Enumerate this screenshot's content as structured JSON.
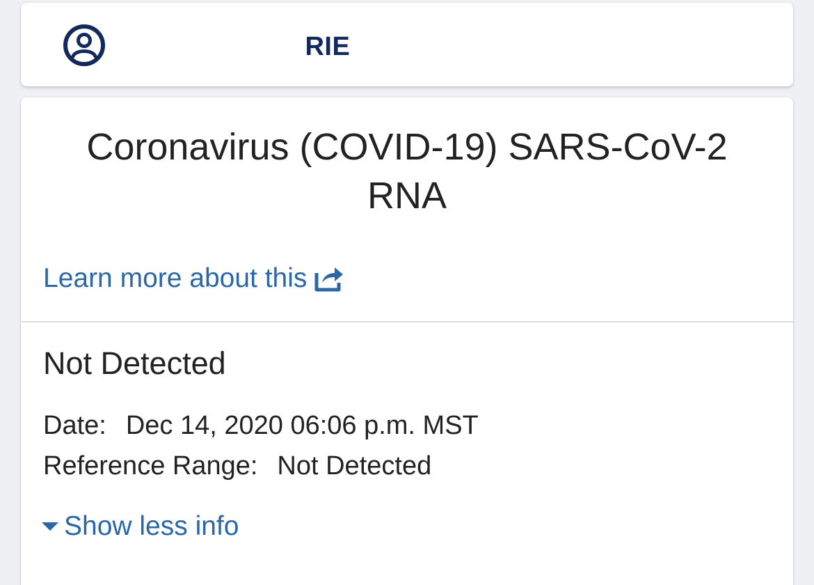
{
  "patient": {
    "name_suffix": "RIE",
    "icon": "user-circle-icon"
  },
  "result": {
    "title": "Coronavirus (COVID-19) SARS-CoV-2 RNA",
    "learn_more_label": "Learn more about this",
    "learn_more_icon": "share-external-icon",
    "value": "Not Detected",
    "date_label": "Date:",
    "date_value": "Dec 14, 2020 06:06 p.m. MST",
    "reference_label": "Reference Range:",
    "reference_value": "Not Detected",
    "toggle_label": "Show less info",
    "toggle_icon": "caret-down-icon"
  },
  "colors": {
    "brand_navy": "#13295e",
    "link_blue": "#2b67a7",
    "text": "#222222"
  }
}
